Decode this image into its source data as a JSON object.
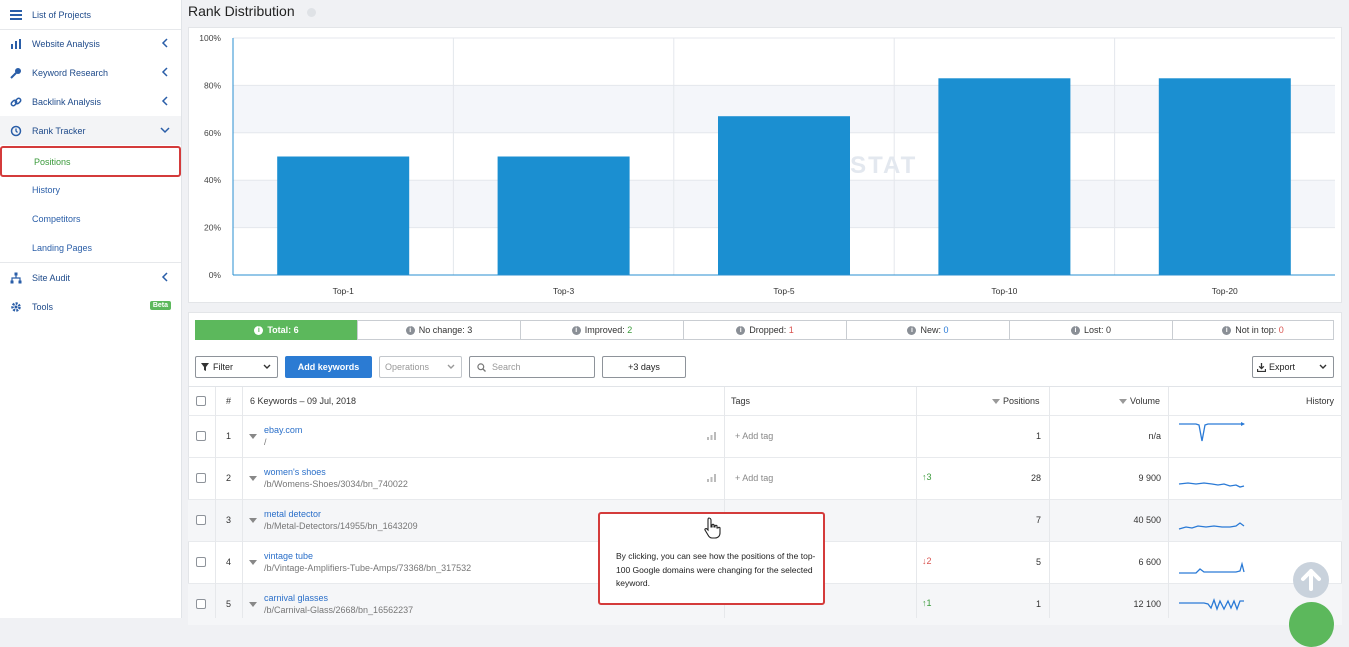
{
  "sidebar": {
    "items": [
      {
        "label": "List of Projects"
      },
      {
        "label": "Website Analysis"
      },
      {
        "label": "Keyword Research"
      },
      {
        "label": "Backlink Analysis"
      },
      {
        "label": "Rank Tracker"
      },
      {
        "label": "Site Audit"
      },
      {
        "label": "Tools",
        "badge": "Beta"
      }
    ],
    "sub_items": [
      {
        "label": "Positions",
        "active": true
      },
      {
        "label": "History"
      },
      {
        "label": "Competitors"
      },
      {
        "label": "Landing Pages"
      }
    ]
  },
  "header": {
    "title": "Rank Distribution"
  },
  "chart_data": {
    "type": "bar",
    "categories": [
      "Top-1",
      "Top-3",
      "Top-5",
      "Top-10",
      "Top-20"
    ],
    "values": [
      50,
      50,
      67,
      83,
      83
    ],
    "yticks": [
      "0%",
      "20%",
      "40%",
      "60%",
      "80%",
      "100%"
    ],
    "ylim": [
      0,
      100
    ],
    "watermark": "SERPSTAT",
    "bar_color": "#1b8fd1"
  },
  "tabs": [
    {
      "label": "Total:",
      "value": "6",
      "active": true
    },
    {
      "label": "No change:",
      "value": "3"
    },
    {
      "label": "Improved:",
      "value": "2"
    },
    {
      "label": "Dropped:",
      "value": "1"
    },
    {
      "label": "New:",
      "value": "0"
    },
    {
      "label": "Lost:",
      "value": "0"
    },
    {
      "label": "Not in top:",
      "value": "0"
    }
  ],
  "toolbar": {
    "filter": "Filter",
    "add_keywords": "Add keywords",
    "operations": "Operations",
    "search_placeholder": "Search",
    "days": "+3 days",
    "export": "Export"
  },
  "table": {
    "headers": {
      "num": "#",
      "keywords": "6 Keywords – 09 Jul, 2018",
      "tags": "Tags",
      "positions": "Positions",
      "volume": "Volume",
      "history": "History"
    },
    "add_tag": "Add tag",
    "rows": [
      {
        "n": "1",
        "keyword": "ebay.com",
        "url": "/",
        "change": "",
        "position": "1",
        "volume": "n/a"
      },
      {
        "n": "2",
        "keyword": "women's shoes",
        "url": "/b/Womens-Shoes/3034/bn_740022",
        "change": "3",
        "position": "28",
        "volume": "9 900"
      },
      {
        "n": "3",
        "keyword": "metal detector",
        "url": "/b/Metal-Detectors/14955/bn_1643209",
        "change": "",
        "position": "7",
        "volume": "40 500"
      },
      {
        "n": "4",
        "keyword": "vintage tube",
        "url": "/b/Vintage-Amplifiers-Tube-Amps/73368/bn_317532",
        "change": "2",
        "position": "5",
        "volume": "6 600"
      },
      {
        "n": "5",
        "keyword": "carnival glasses",
        "url": "/b/Carnival-Glass/2668/bn_16562237",
        "change": "1",
        "position": "1",
        "volume": "12 100"
      }
    ]
  },
  "tooltip": {
    "text": "By clicking, you can see how the positions of the top-100 Google domains were changing for the selected keyword."
  }
}
